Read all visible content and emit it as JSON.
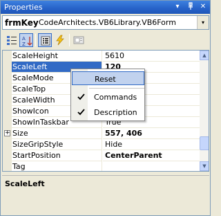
{
  "titlebar": {
    "title": "Properties",
    "buttons": [
      "▾",
      "ᚬ",
      "✕"
    ]
  },
  "object_selector": {
    "name": "frmKey",
    "type": "CodeArchitects.VB6Library.VB6Form",
    "dropdown_icon": "▾"
  },
  "toolbar": {
    "icons": [
      "categorized-icon",
      "alphabetical-icon",
      "properties-icon",
      "events-icon",
      "property-pages-icon"
    ]
  },
  "grid": {
    "rows": [
      {
        "name": "ScaleHeight",
        "value": "5610",
        "bold": false
      },
      {
        "name": "ScaleLeft",
        "value": "120",
        "bold": true,
        "selected": true
      },
      {
        "name": "ScaleMode",
        "value": "",
        "bold": false
      },
      {
        "name": "ScaleTop",
        "value": "",
        "bold": false
      },
      {
        "name": "ScaleWidth",
        "value": "",
        "bold": false
      },
      {
        "name": "ShowIcon",
        "value": "",
        "bold": false
      },
      {
        "name": "ShowInTaskbar",
        "value": "True",
        "bold": false
      },
      {
        "name": "Size",
        "value": "557, 406",
        "bold": true,
        "expander": "+"
      },
      {
        "name": "SizeGripStyle",
        "value": "Hide",
        "bold": false
      },
      {
        "name": "StartPosition",
        "value": "CenterParent",
        "bold": true
      },
      {
        "name": "Tag",
        "value": "",
        "bold": false
      }
    ],
    "scroll": {
      "up": "▲",
      "down": "▼"
    }
  },
  "context_menu": {
    "items": [
      {
        "label": "Reset",
        "checked": false,
        "hover": true
      },
      {
        "label": "Commands",
        "checked": true
      },
      {
        "label": "Description",
        "checked": true
      }
    ]
  },
  "description": {
    "title": "ScaleLeft"
  },
  "colors": {
    "title_bar": "#2662c8",
    "selection": "#316ac5",
    "hover": "#c1d2ee",
    "panel": "#ece9d8"
  }
}
